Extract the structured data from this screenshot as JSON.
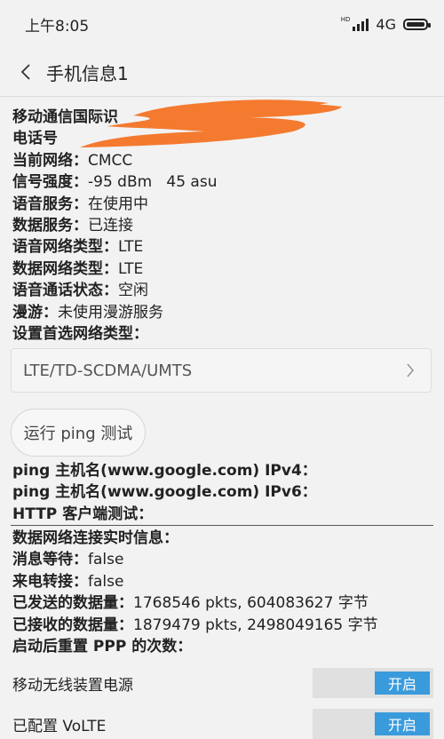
{
  "status_bar": {
    "time": "上午8:05",
    "network": "4G",
    "hd_label": "HD"
  },
  "header": {
    "title": "手机信息1"
  },
  "info_rows": [
    {
      "label": "移动通信国际识",
      "value": ""
    },
    {
      "label": "电话号",
      "value": ""
    },
    {
      "label": "当前网络：",
      "value": "CMCC"
    },
    {
      "label": "信号强度：",
      "value": "-95 dBm   45 asu"
    },
    {
      "label": "语音服务：",
      "value": "在使用中"
    },
    {
      "label": "数据服务：",
      "value": "已连接"
    },
    {
      "label": "语音网络类型：",
      "value": "LTE"
    },
    {
      "label": "数据网络类型：",
      "value": "LTE"
    },
    {
      "label": "语音通话状态：",
      "value": "空闲"
    },
    {
      "label": "漫游：",
      "value": "未使用漫游服务"
    },
    {
      "label": "设置首选网络类型：",
      "value": ""
    }
  ],
  "preferred_network": {
    "selected": "LTE/TD-SCDMA/UMTS"
  },
  "ping_button": {
    "label": "运行 ping 测试"
  },
  "ping_rows": [
    "ping 主机名(www.google.com) IPv4：",
    "ping 主机名(www.google.com) IPv6：",
    "HTTP 客户端测试："
  ],
  "realtime_rows": [
    {
      "label": "数据网络连接实时信息：",
      "value": ""
    },
    {
      "label": "消息等待：",
      "value": "false"
    },
    {
      "label": "来电转接：",
      "value": "false"
    },
    {
      "label": "已发送的数据量：",
      "value": "1768546 pkts, 604083627 字节"
    },
    {
      "label": "已接收的数据量：",
      "value": "1879479 pkts, 2498049165 字节"
    },
    {
      "label": "启动后重置 PPP 的次数：",
      "value": ""
    }
  ],
  "toggles": [
    {
      "label": "移动无线装置电源",
      "state": "开启"
    },
    {
      "label": "已配置 VoLTE",
      "state": "开启"
    }
  ],
  "colors": {
    "accent": "#3a9bdc",
    "redaction": "#f47a2f"
  }
}
